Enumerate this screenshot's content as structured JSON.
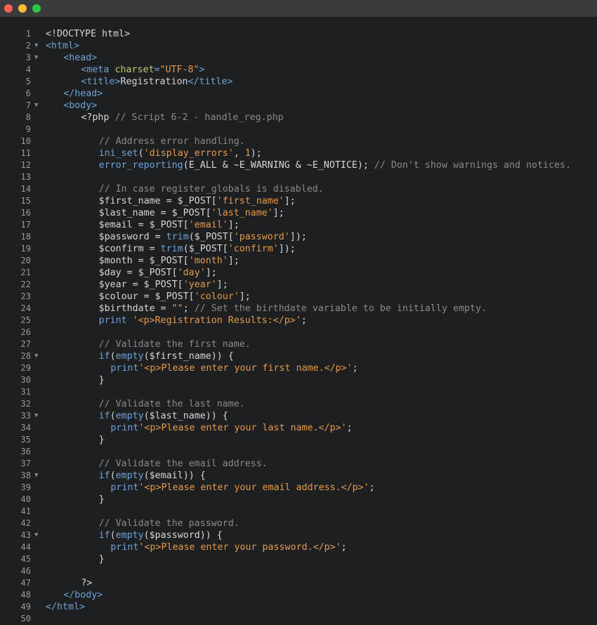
{
  "window": {
    "traffic_lights": {
      "close_color": "#ff5f57",
      "minimize_color": "#febc2e",
      "maximize_color": "#28c840"
    }
  },
  "editor": {
    "lines": [
      {
        "n": "1",
        "fold": false,
        "indent": 0,
        "tokens": [
          [
            "<!DOCTYPE html>",
            "plain"
          ]
        ]
      },
      {
        "n": "2",
        "fold": true,
        "indent": 0,
        "tokens": [
          [
            "<html>",
            "tag"
          ]
        ]
      },
      {
        "n": "3",
        "fold": true,
        "indent": 3,
        "tokens": [
          [
            "<head>",
            "tag"
          ]
        ]
      },
      {
        "n": "4",
        "fold": false,
        "indent": 6,
        "tokens": [
          [
            "<meta ",
            "tag"
          ],
          [
            "charset",
            "attr"
          ],
          [
            "=",
            "tag"
          ],
          [
            "\"UTF-8\"",
            "str"
          ],
          [
            ">",
            "tag"
          ]
        ]
      },
      {
        "n": "5",
        "fold": false,
        "indent": 6,
        "tokens": [
          [
            "<title>",
            "tag"
          ],
          [
            "Registration",
            "plain"
          ],
          [
            "</title>",
            "tag"
          ]
        ]
      },
      {
        "n": "6",
        "fold": false,
        "indent": 3,
        "tokens": [
          [
            "</head>",
            "tag"
          ]
        ]
      },
      {
        "n": "7",
        "fold": true,
        "indent": 3,
        "tokens": [
          [
            "<body>",
            "tag"
          ]
        ]
      },
      {
        "n": "8",
        "fold": false,
        "indent": 6,
        "tokens": [
          [
            "<?php ",
            "plain"
          ],
          [
            "// Script 6-2 - handle_reg.php",
            "comment"
          ]
        ]
      },
      {
        "n": "9",
        "fold": false,
        "indent": 0,
        "tokens": []
      },
      {
        "n": "10",
        "fold": false,
        "indent": 9,
        "tokens": [
          [
            "// Address error handling.",
            "comment"
          ]
        ]
      },
      {
        "n": "11",
        "fold": false,
        "indent": 9,
        "tokens": [
          [
            "ini_set",
            "func"
          ],
          [
            "(",
            "plain"
          ],
          [
            "'display_errors'",
            "str"
          ],
          [
            ", ",
            "plain"
          ],
          [
            "1",
            "num"
          ],
          [
            ");",
            "plain"
          ]
        ]
      },
      {
        "n": "12",
        "fold": false,
        "indent": 9,
        "tokens": [
          [
            "error_reporting",
            "func"
          ],
          [
            "(E_ALL & ~E_WARNING & ~E_NOTICE); ",
            "plain"
          ],
          [
            "// Don't show warnings and notices.",
            "comment"
          ]
        ]
      },
      {
        "n": "13",
        "fold": false,
        "indent": 0,
        "tokens": []
      },
      {
        "n": "14",
        "fold": false,
        "indent": 9,
        "tokens": [
          [
            "// In case register_globals is disabled.",
            "comment"
          ]
        ]
      },
      {
        "n": "15",
        "fold": false,
        "indent": 9,
        "tokens": [
          [
            "$first_name = $_POST[",
            "plain"
          ],
          [
            "'first_name'",
            "str"
          ],
          [
            "];",
            "plain"
          ]
        ]
      },
      {
        "n": "16",
        "fold": false,
        "indent": 9,
        "tokens": [
          [
            "$last_name = $_POST[",
            "plain"
          ],
          [
            "'last_name'",
            "str"
          ],
          [
            "];",
            "plain"
          ]
        ]
      },
      {
        "n": "17",
        "fold": false,
        "indent": 9,
        "tokens": [
          [
            "$email = $_POST[",
            "plain"
          ],
          [
            "'email'",
            "str"
          ],
          [
            "];",
            "plain"
          ]
        ]
      },
      {
        "n": "18",
        "fold": false,
        "indent": 9,
        "tokens": [
          [
            "$password = ",
            "plain"
          ],
          [
            "trim",
            "func"
          ],
          [
            "($_POST[",
            "plain"
          ],
          [
            "'password'",
            "str"
          ],
          [
            "]);",
            "plain"
          ]
        ]
      },
      {
        "n": "19",
        "fold": false,
        "indent": 9,
        "tokens": [
          [
            "$confirm = ",
            "plain"
          ],
          [
            "trim",
            "func"
          ],
          [
            "($_POST[",
            "plain"
          ],
          [
            "'confirm'",
            "str"
          ],
          [
            "]);",
            "plain"
          ]
        ]
      },
      {
        "n": "20",
        "fold": false,
        "indent": 9,
        "tokens": [
          [
            "$month = $_POST[",
            "plain"
          ],
          [
            "'month'",
            "str"
          ],
          [
            "];",
            "plain"
          ]
        ]
      },
      {
        "n": "21",
        "fold": false,
        "indent": 9,
        "tokens": [
          [
            "$day = $_POST[",
            "plain"
          ],
          [
            "'day'",
            "str"
          ],
          [
            "];",
            "plain"
          ]
        ]
      },
      {
        "n": "22",
        "fold": false,
        "indent": 9,
        "tokens": [
          [
            "$year = $_POST[",
            "plain"
          ],
          [
            "'year'",
            "str"
          ],
          [
            "];",
            "plain"
          ]
        ]
      },
      {
        "n": "23",
        "fold": false,
        "indent": 9,
        "tokens": [
          [
            "$colour = $_POST[",
            "plain"
          ],
          [
            "'colour'",
            "str"
          ],
          [
            "];",
            "plain"
          ]
        ]
      },
      {
        "n": "24",
        "fold": false,
        "indent": 9,
        "tokens": [
          [
            "$birthdate = ",
            "plain"
          ],
          [
            "\"\"",
            "str"
          ],
          [
            "; ",
            "plain"
          ],
          [
            "// Set the birthdate variable to be initially empty.",
            "comment"
          ]
        ]
      },
      {
        "n": "25",
        "fold": false,
        "indent": 9,
        "tokens": [
          [
            "print ",
            "func"
          ],
          [
            "'<p>Registration Results:</p>'",
            "str"
          ],
          [
            ";",
            "plain"
          ]
        ]
      },
      {
        "n": "26",
        "fold": false,
        "indent": 0,
        "tokens": []
      },
      {
        "n": "27",
        "fold": false,
        "indent": 9,
        "tokens": [
          [
            "// Validate the first name.",
            "comment"
          ]
        ]
      },
      {
        "n": "28",
        "fold": true,
        "indent": 9,
        "tokens": [
          [
            "if",
            "func"
          ],
          [
            "(",
            "plain"
          ],
          [
            "empty",
            "func"
          ],
          [
            "($first_name)) {",
            "plain"
          ]
        ]
      },
      {
        "n": "29",
        "fold": false,
        "indent": 11,
        "tokens": [
          [
            "print",
            "func"
          ],
          [
            "'<p>Please enter your first name.</p>'",
            "str"
          ],
          [
            ";",
            "plain"
          ]
        ]
      },
      {
        "n": "30",
        "fold": false,
        "indent": 9,
        "tokens": [
          [
            "}",
            "plain"
          ]
        ]
      },
      {
        "n": "31",
        "fold": false,
        "indent": 0,
        "tokens": []
      },
      {
        "n": "32",
        "fold": false,
        "indent": 9,
        "tokens": [
          [
            "// Validate the last name.",
            "comment"
          ]
        ]
      },
      {
        "n": "33",
        "fold": true,
        "indent": 9,
        "tokens": [
          [
            "if",
            "func"
          ],
          [
            "(",
            "plain"
          ],
          [
            "empty",
            "func"
          ],
          [
            "($last_name)) {",
            "plain"
          ]
        ]
      },
      {
        "n": "34",
        "fold": false,
        "indent": 11,
        "tokens": [
          [
            "print",
            "func"
          ],
          [
            "'<p>Please enter your last name.</p>'",
            "str"
          ],
          [
            ";",
            "plain"
          ]
        ]
      },
      {
        "n": "35",
        "fold": false,
        "indent": 9,
        "tokens": [
          [
            "}",
            "plain"
          ]
        ]
      },
      {
        "n": "36",
        "fold": false,
        "indent": 0,
        "tokens": []
      },
      {
        "n": "37",
        "fold": false,
        "indent": 9,
        "tokens": [
          [
            "// Validate the email address.",
            "comment"
          ]
        ]
      },
      {
        "n": "38",
        "fold": true,
        "indent": 9,
        "tokens": [
          [
            "if",
            "func"
          ],
          [
            "(",
            "plain"
          ],
          [
            "empty",
            "func"
          ],
          [
            "($email)) {",
            "plain"
          ]
        ]
      },
      {
        "n": "39",
        "fold": false,
        "indent": 11,
        "tokens": [
          [
            "print",
            "func"
          ],
          [
            "'<p>Please enter your email address.</p>'",
            "str"
          ],
          [
            ";",
            "plain"
          ]
        ]
      },
      {
        "n": "40",
        "fold": false,
        "indent": 9,
        "tokens": [
          [
            "}",
            "plain"
          ]
        ]
      },
      {
        "n": "41",
        "fold": false,
        "indent": 0,
        "tokens": []
      },
      {
        "n": "42",
        "fold": false,
        "indent": 9,
        "tokens": [
          [
            "// Validate the password.",
            "comment"
          ]
        ]
      },
      {
        "n": "43",
        "fold": true,
        "indent": 9,
        "tokens": [
          [
            "if",
            "func"
          ],
          [
            "(",
            "plain"
          ],
          [
            "empty",
            "func"
          ],
          [
            "($password)) {",
            "plain"
          ]
        ]
      },
      {
        "n": "44",
        "fold": false,
        "indent": 11,
        "tokens": [
          [
            "print",
            "func"
          ],
          [
            "'<p>Please enter your password.</p>'",
            "str"
          ],
          [
            ";",
            "plain"
          ]
        ]
      },
      {
        "n": "45",
        "fold": false,
        "indent": 9,
        "tokens": [
          [
            "}",
            "plain"
          ]
        ]
      },
      {
        "n": "46",
        "fold": false,
        "indent": 0,
        "tokens": []
      },
      {
        "n": "47",
        "fold": false,
        "indent": 6,
        "tokens": [
          [
            "?>",
            "plain"
          ]
        ]
      },
      {
        "n": "48",
        "fold": false,
        "indent": 3,
        "tokens": [
          [
            "</body>",
            "tag"
          ]
        ]
      },
      {
        "n": "49",
        "fold": false,
        "indent": 0,
        "tokens": [
          [
            "</html>",
            "tag"
          ]
        ]
      },
      {
        "n": "50",
        "fold": false,
        "indent": 0,
        "tokens": []
      }
    ]
  }
}
